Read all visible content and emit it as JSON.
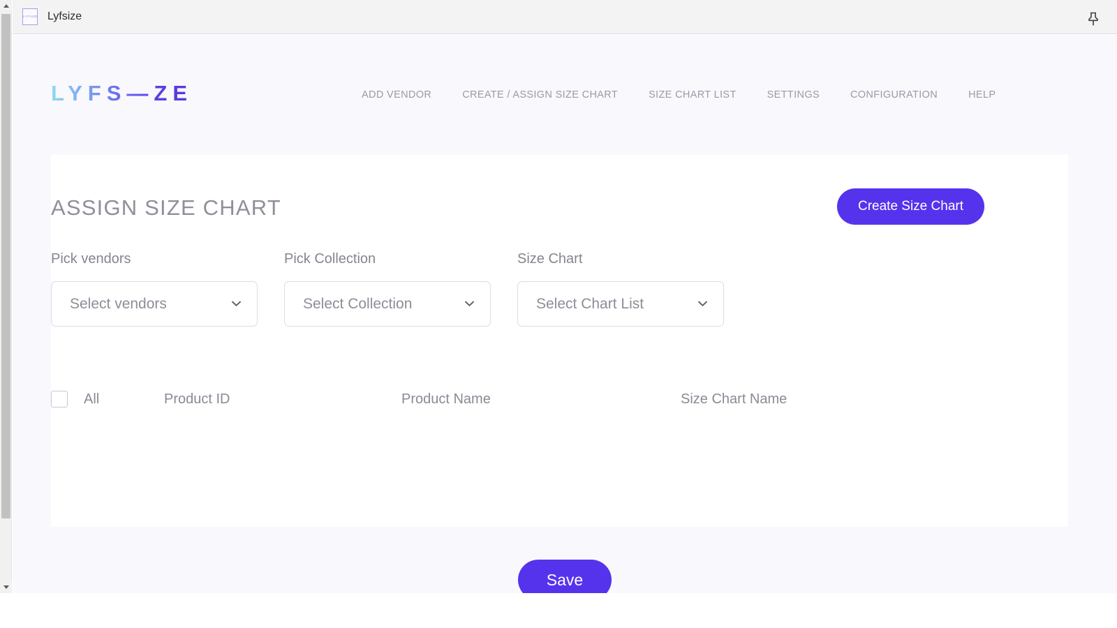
{
  "browser": {
    "tab_title": "Lyfsize",
    "favicon_text": "LYFSIZE",
    "pin_icon": "pushpin-icon",
    "scrollbar_up_icon": "scroll-up-arrow-icon",
    "scrollbar_down_icon": "scroll-down-arrow-icon"
  },
  "header": {
    "logo_parts": [
      "L",
      "Y",
      "F",
      "S",
      "—",
      "Z",
      "E"
    ],
    "logo_text": "LYFS—ZE",
    "nav": [
      {
        "label": "ADD VENDOR",
        "name": "nav-add-vendor"
      },
      {
        "label": "CREATE / ASSIGN SIZE CHART",
        "name": "nav-create-assign-size-chart"
      },
      {
        "label": "SIZE CHART LIST",
        "name": "nav-size-chart-list"
      },
      {
        "label": "SETTINGS",
        "name": "nav-settings"
      },
      {
        "label": "CONFIGURATION",
        "name": "nav-configuration"
      },
      {
        "label": "HELP",
        "name": "nav-help"
      }
    ]
  },
  "main": {
    "page_title": "ASSIGN SIZE CHART",
    "create_button_label": "Create Size Chart",
    "fields": [
      {
        "label": "Pick vendors",
        "value": "Select vendors",
        "name": "pick-vendors"
      },
      {
        "label": "Pick Collection",
        "value": "Select Collection",
        "name": "pick-collection"
      },
      {
        "label": "Size Chart",
        "value": "Select Chart List",
        "name": "size-chart"
      }
    ],
    "table": {
      "select_all_label": "All",
      "columns": [
        "Product ID",
        "Product Name",
        "Size Chart Name"
      ],
      "rows": []
    },
    "save_button_label": "Save"
  },
  "colors": {
    "accent": "#5533ed",
    "page_bg": "#f9f8fd",
    "card_bg": "#ffffff",
    "muted_text": "#8b8a95",
    "nav_text": "#9b9aa6",
    "logo_gradient_start": "#8fd9f2",
    "logo_gradient_end": "#5a33e0"
  }
}
